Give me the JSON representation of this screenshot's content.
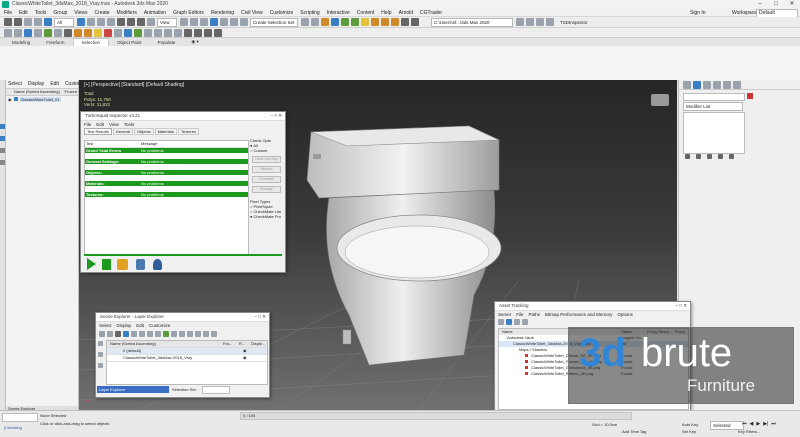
{
  "app": {
    "title": "ClassicWhiteToilet_3dsMax_2018_Vray.max - Autodesk 3ds Max 2020",
    "sign_in": "Sign In",
    "workspaces_label": "Workspaces:",
    "workspace": "Default"
  },
  "menu": [
    "File",
    "Edit",
    "Tools",
    "Group",
    "Views",
    "Create",
    "Modifiers",
    "Animation",
    "Graph Editors",
    "Rendering",
    "Civil View",
    "Customize",
    "Scripting",
    "Interactive",
    "Content",
    "Help",
    "Arnold",
    "CGTrader"
  ],
  "toolbar": {
    "filter": "All",
    "view": "View",
    "selection_set": "Create Selection Set",
    "path": "C:\\Users\\sf...\\3ds Max 2020",
    "inspector": "TSDInspector"
  },
  "ribbon_tabs": [
    "Modeling",
    "Freeform",
    "Selection",
    "Object Paint",
    "Populate"
  ],
  "ribbon_selected": "Selection",
  "scene_explorer": {
    "tabs": [
      "Select",
      "Display",
      "Edit",
      "Customize"
    ],
    "header": "Name (Sorted Ascending)",
    "frozen": "Frozen",
    "item": "ClassicWhiteToilet_01",
    "footer": "Scene Explorer"
  },
  "viewport": {
    "label": "[+] [Perspective] [Standard] [Default Shading]",
    "stats_total": "Total",
    "polys": "Polys: 11,750",
    "verts": "Verts: 11,822"
  },
  "inspector_dialog": {
    "title": "TurboSquid Inspector v3.21",
    "menu": [
      "File",
      "Edit",
      "View",
      "Tools"
    ],
    "tabs": [
      "Test Results",
      "General",
      "Objects",
      "Materials",
      "Textures"
    ],
    "col_test": "Test",
    "col_message": "Message",
    "rows": [
      {
        "test": "Grand Total Errors",
        "message": "No problems"
      },
      {
        "test": "General Settings:",
        "message": "No problems"
      },
      {
        "test": "Objects:",
        "message": "No problems"
      },
      {
        "test": "Materials:",
        "message": "No problems"
      },
      {
        "test": "Textures:",
        "message": "No problems"
      }
    ],
    "check_opts": "Check Opts",
    "opt_all": "All",
    "opt_custom": "Custom",
    "buttons": [
      "Clear Box Ray",
      "Rescan",
      "Generate",
      "Manage"
    ],
    "pixel_types": "Pixel Types",
    "px1": "PixelSquid",
    "px2": "CheckMate Lite",
    "px3": "CheckMate Pro"
  },
  "layer_explorer": {
    "title": "Scene Explorer - Layer Explorer",
    "tabs": [
      "Select",
      "Display",
      "Edit",
      "Customize"
    ],
    "header": "Name (Sorted Ascending)",
    "col_frozen": "Fro...",
    "col_render": "R...",
    "col_display": "Disple...",
    "rows": [
      "0 (default)",
      "ClassicWhiteToilet_3dsMax-2018_Vray"
    ],
    "footer": "Layer Explorer",
    "selection_set": "Selection Set:"
  },
  "asset_tracking": {
    "title": "Asset Tracking",
    "menu": [
      "Server",
      "File",
      "Paths",
      "Bitmap Performance and Memory",
      "Options"
    ],
    "col_name": "Name",
    "col_status": "Status",
    "col_proxy": "Proxy Resol...",
    "col_proxy2": "Proxy",
    "rows": [
      {
        "name": "Autodesk Vault",
        "status": "Logged Ou..."
      },
      {
        "name": "ClassicWhiteToilet_3dsMax-2018_Vray.max",
        "status": "Ok"
      },
      {
        "name": "Maps / Shaders",
        "status": ""
      },
      {
        "name": "ClassicWhiteToilet_Diffuse_DK_4K.png",
        "status": "Found"
      },
      {
        "name": "ClassicWhiteToilet_Fresnel_DK_4K.png",
        "status": "Found"
      },
      {
        "name": "ClassicWhiteToilet_Glossiness_4K.png",
        "status": "Found"
      },
      {
        "name": "ClassicWhiteToilet_Reflect_4K.png",
        "status": "Found"
      }
    ]
  },
  "command_panel": {
    "modifier_list": "Modifier List"
  },
  "status": {
    "maxscript": "[Checking",
    "none_selected": "None Selected",
    "hint": "Click or click-and-drag to select objects",
    "grid": "Grid = 10.0cm",
    "add_time_tag": "Add Time Tag",
    "auto_key": "Auto Key",
    "set_key": "Set Key",
    "selected": "Selected",
    "key_filters": "Key Filters...",
    "frames": "0 / 100"
  },
  "watermark": {
    "brand_a": "3d",
    "brand_b": "brute",
    "sub": "Furniture"
  },
  "colors": {
    "green": "#1d9a1d",
    "accent": "#2a7fd0",
    "watermark": "#2f86d8"
  }
}
